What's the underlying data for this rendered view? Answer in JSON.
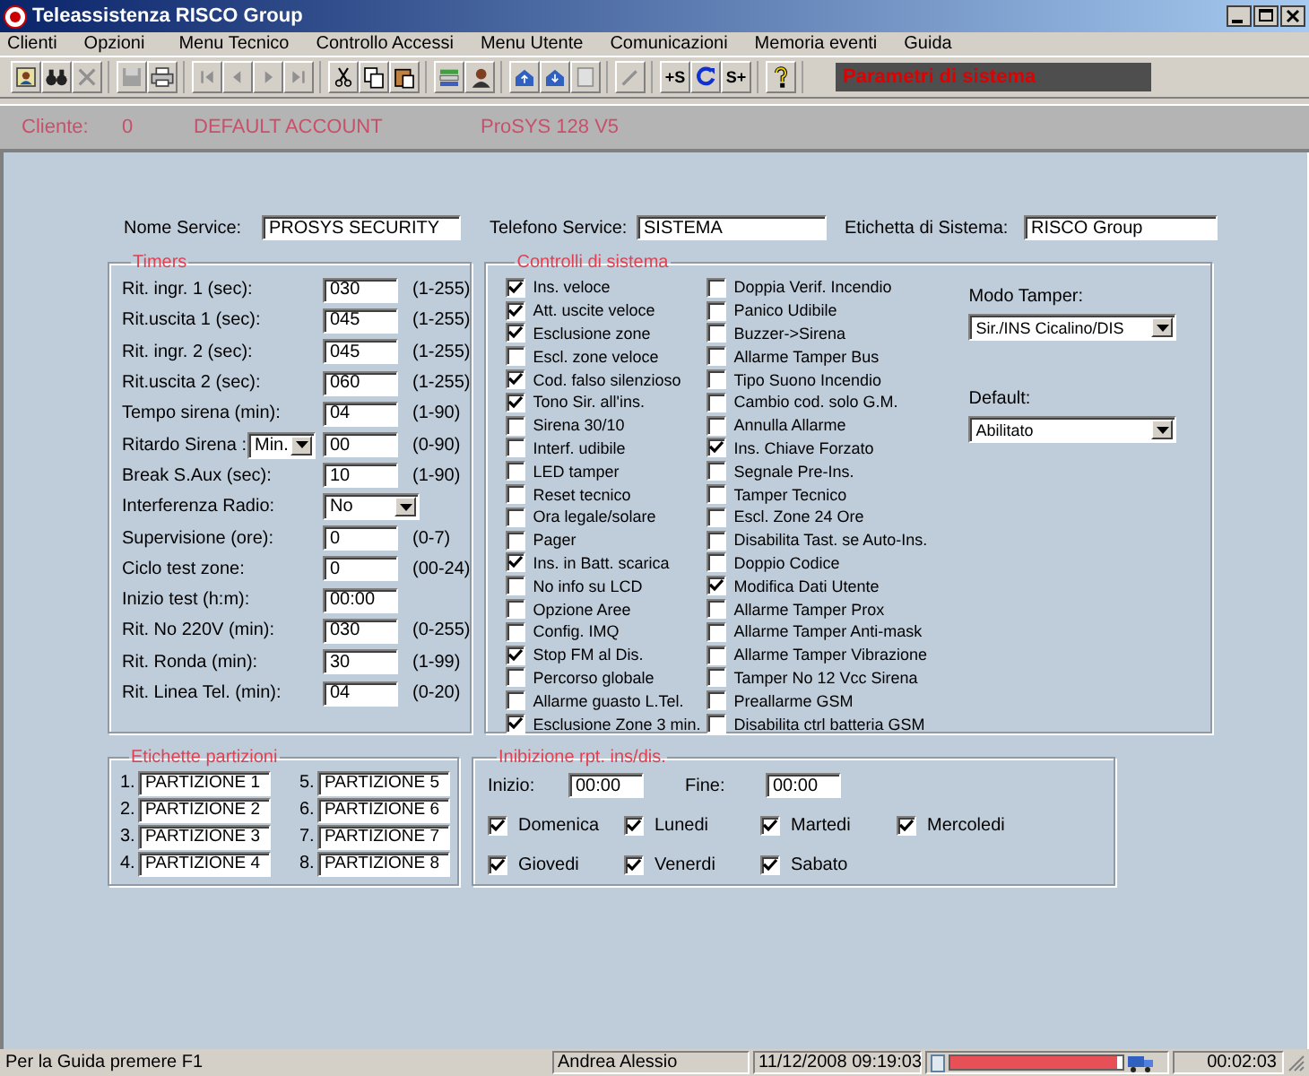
{
  "window": {
    "title": "Teleassistenza RISCO Group"
  },
  "menu": [
    "Clienti",
    "Opzioni",
    "Menu Tecnico",
    "Controllo Accessi",
    "Menu Utente",
    "Comunicazioni",
    "Memoria eventi",
    "Guida"
  ],
  "toolbar": {
    "labels": [
      "+S",
      "S+"
    ],
    "caption": "Parametri di sistema"
  },
  "client_bar": {
    "label": "Cliente:",
    "number": "0",
    "account": "DEFAULT ACCOUNT",
    "panel": "ProSYS 128 V5"
  },
  "header_fields": [
    {
      "label": "Nome Service:",
      "value": "PROSYS SECURITY"
    },
    {
      "label": "Telefono Service:",
      "value": "SISTEMA"
    },
    {
      "label": "Etichetta di Sistema:",
      "value": "RISCO Group"
    }
  ],
  "timers": {
    "title": "Timers",
    "rows": [
      {
        "kind": "text",
        "label": "Rit. ingr. 1 (sec):",
        "value": "030",
        "range": "(1-255)"
      },
      {
        "kind": "text",
        "label": "Rit.uscita 1 (sec):",
        "value": "045",
        "range": "(1-255)"
      },
      {
        "kind": "text",
        "label": "Rit. ingr. 2 (sec):",
        "value": "045",
        "range": "(1-255)"
      },
      {
        "kind": "text",
        "label": "Rit.uscita 2 (sec):",
        "value": "060",
        "range": "(1-255)"
      },
      {
        "kind": "text",
        "label": "Tempo sirena (min):",
        "value": "04",
        "range": "(1-90)"
      },
      {
        "kind": "unit",
        "label": "Ritardo Sirena :",
        "unit": "Min.",
        "value": "00",
        "range": "(0-90)"
      },
      {
        "kind": "text",
        "label": "Break S.Aux (sec):",
        "value": "10",
        "range": "(1-90)"
      },
      {
        "kind": "select",
        "label": "Interferenza Radio:",
        "value": "No"
      },
      {
        "kind": "text",
        "label": "Supervisione (ore):",
        "value": "0",
        "range": "(0-7)"
      },
      {
        "kind": "text",
        "label": "Ciclo test zone:",
        "value": "0",
        "range": "(00-24)"
      },
      {
        "kind": "text",
        "label": "Inizio test (h:m):",
        "value": "00:00"
      },
      {
        "kind": "text",
        "label": "Rit. No 220V (min):",
        "value": "030",
        "range": "(0-255)"
      },
      {
        "kind": "text",
        "label": "Rit. Ronda (min):",
        "value": "30",
        "range": "(1-99)"
      },
      {
        "kind": "text",
        "label": "Rit. Linea Tel. (min):",
        "value": "04",
        "range": "(0-20)"
      }
    ]
  },
  "system_controls": {
    "title": "Controlli di sistema",
    "columns": [
      [
        {
          "label": "Ins. veloce",
          "checked": true
        },
        {
          "label": "Att. uscite veloce",
          "checked": true
        },
        {
          "label": "Esclusione zone",
          "checked": true
        },
        {
          "label": "Escl. zone veloce",
          "checked": false
        },
        {
          "label": "Cod. falso silenzioso",
          "checked": true
        },
        {
          "label": "Tono Sir. all'ins.",
          "checked": true
        },
        {
          "label": "Sirena 30/10",
          "checked": false
        },
        {
          "label": "Interf. udibile",
          "checked": false
        },
        {
          "label": "LED tamper",
          "checked": false
        },
        {
          "label": "Reset tecnico",
          "checked": false
        },
        {
          "label": "Ora legale/solare",
          "checked": false
        },
        {
          "label": "Pager",
          "checked": false
        },
        {
          "label": "Ins. in Batt. scarica",
          "checked": true
        },
        {
          "label": "No info su LCD",
          "checked": false
        },
        {
          "label": "Opzione Aree",
          "checked": false
        },
        {
          "label": "Config. IMQ",
          "checked": false
        },
        {
          "label": "Stop FM al Dis.",
          "checked": true
        },
        {
          "label": "Percorso globale",
          "checked": false
        },
        {
          "label": "Allarme guasto L.Tel.",
          "checked": false
        },
        {
          "label": "Esclusione Zone 3 min.",
          "checked": true
        }
      ],
      [
        {
          "label": "Doppia Verif. Incendio",
          "checked": false
        },
        {
          "label": "Panico Udibile",
          "checked": false
        },
        {
          "label": "Buzzer->Sirena",
          "checked": false
        },
        {
          "label": "Allarme Tamper Bus",
          "checked": false
        },
        {
          "label": "Tipo Suono Incendio",
          "checked": false
        },
        {
          "label": "Cambio cod. solo G.M.",
          "checked": false
        },
        {
          "label": "Annulla Allarme",
          "checked": false
        },
        {
          "label": "Ins. Chiave Forzato",
          "checked": true
        },
        {
          "label": "Segnale Pre-Ins.",
          "checked": false
        },
        {
          "label": "Tamper Tecnico",
          "checked": false
        },
        {
          "label": "Escl. Zone 24 Ore",
          "checked": false
        },
        {
          "label": "Disabilita Tast. se Auto-Ins.",
          "checked": false
        },
        {
          "label": "Doppio Codice",
          "checked": false
        },
        {
          "label": "Modifica Dati Utente",
          "checked": true
        },
        {
          "label": "Allarme Tamper Prox",
          "checked": false
        },
        {
          "label": "Allarme Tamper Anti-mask",
          "checked": false
        },
        {
          "label": "Allarme Tamper Vibrazione",
          "checked": false
        },
        {
          "label": "Tamper No 12 Vcc Sirena",
          "checked": false
        },
        {
          "label": "Preallarme GSM",
          "checked": false
        },
        {
          "label": "Disabilita ctrl batteria GSM",
          "checked": false
        }
      ]
    ],
    "selects": [
      {
        "label": "Modo Tamper:",
        "value": "Sir./INS Cicalino/DIS"
      },
      {
        "label": "Default:",
        "value": "Abilitato"
      }
    ]
  },
  "partition_labels": {
    "title": "Etichette partizioni",
    "items": [
      {
        "number": "1.",
        "value": "PARTIZIONE 1"
      },
      {
        "number": "2.",
        "value": "PARTIZIONE 2"
      },
      {
        "number": "3.",
        "value": "PARTIZIONE 3"
      },
      {
        "number": "4.",
        "value": "PARTIZIONE 4"
      },
      {
        "number": "5.",
        "value": "PARTIZIONE 5"
      },
      {
        "number": "6.",
        "value": "PARTIZIONE 6"
      },
      {
        "number": "7.",
        "value": "PARTIZIONE 7"
      },
      {
        "number": "8.",
        "value": "PARTIZIONE 8"
      }
    ]
  },
  "inhibition": {
    "title": "Inibizione rpt. ins/dis.",
    "start_label": "Inizio:",
    "start": "00:00",
    "end_label": "Fine:",
    "end": "00:00",
    "days": [
      {
        "label": "Domenica",
        "checked": true
      },
      {
        "label": "Lunedi",
        "checked": true
      },
      {
        "label": "Martedi",
        "checked": true
      },
      {
        "label": "Mercoledi",
        "checked": true
      },
      {
        "label": "Giovedi",
        "checked": true
      },
      {
        "label": "Venerdi",
        "checked": true
      },
      {
        "label": "Sabato",
        "checked": true
      }
    ]
  },
  "status_bar": {
    "hint": "Per la Guida premere F1",
    "user": "Andrea Alessio",
    "datetime": "11/12/2008 09:19:03",
    "level": 0.97,
    "elapsed": "00:02:03"
  }
}
